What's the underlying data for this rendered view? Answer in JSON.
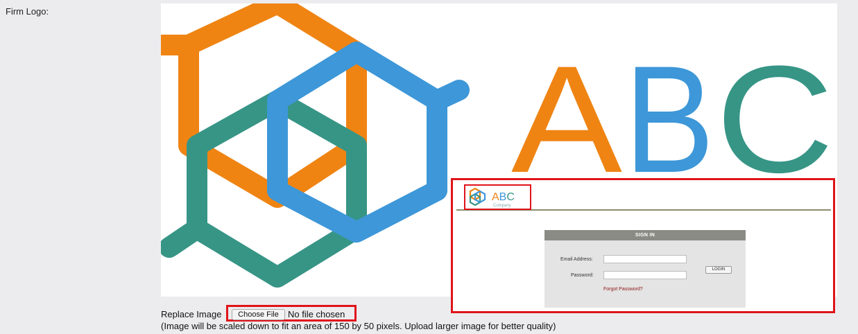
{
  "form": {
    "firm_logo_label": "Firm Logo:",
    "replace_image_label": "Replace Image",
    "choose_file_button": "Choose File",
    "file_status": "No file chosen",
    "hint": "(Image will be scaled down to fit an area of 150 by 50 pixels. Upload larger image for better quality)"
  },
  "logo": {
    "text": "ABC",
    "mini_subtitle": "Company",
    "colors": {
      "orange": "#ef8413",
      "blue": "#3d97d8",
      "teal": "#379586"
    }
  },
  "preview": {
    "signin_title": "SIGN IN",
    "email_label": "Email Address:",
    "password_label": "Password:",
    "login_button": "LOGIN",
    "forgot_password": "Forgot Password?"
  },
  "annotations": {
    "highlight_color": "#e0131a"
  }
}
